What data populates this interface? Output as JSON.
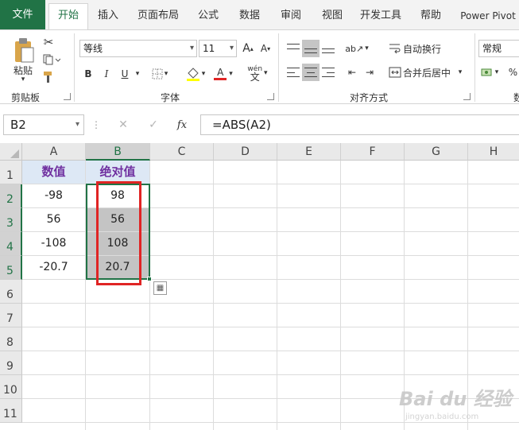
{
  "tabs": [
    "文件",
    "开始",
    "插入",
    "页面布局",
    "公式",
    "数据",
    "审阅",
    "视图",
    "开发工具",
    "帮助",
    "Power Pivot"
  ],
  "active_tab": "开始",
  "clipboard": {
    "paste_label": "粘贴",
    "group_label": "剪贴板"
  },
  "font": {
    "name": "等线",
    "size": "11",
    "bold": "B",
    "italic": "I",
    "underline": "U",
    "font_color_glyph": "A",
    "phonetic_glyph": "wén",
    "group_label": "字体"
  },
  "alignment": {
    "wrap_label": "自动换行",
    "merge_label": "合并后居中",
    "group_label": "对齐方式"
  },
  "number": {
    "format": "常规",
    "percent": "%",
    "group_label_partial": "数"
  },
  "formula_bar": {
    "name_box": "B2",
    "fx": "fx",
    "formula": "=ABS(A2)"
  },
  "columns": [
    "A",
    "B",
    "C",
    "D",
    "E",
    "F",
    "G",
    "H"
  ],
  "rows": [
    "1",
    "2",
    "3",
    "4",
    "5",
    "6",
    "7",
    "8",
    "9",
    "10",
    "11"
  ],
  "cells": {
    "A1": "数值",
    "B1": "绝对值",
    "A2": "-98",
    "B2": "98",
    "A3": "56",
    "B3": "56",
    "A4": "-108",
    "B4": "108",
    "A5": "-20.7",
    "B5": "20.7"
  },
  "watermark": {
    "brand": "Bai du 经验",
    "url": "jingyan.baidu.com"
  },
  "colors": {
    "accent_green": "#217346",
    "header_fill": "#dde8f5",
    "header_text": "#7030a0",
    "highlight_red": "#e02424"
  }
}
